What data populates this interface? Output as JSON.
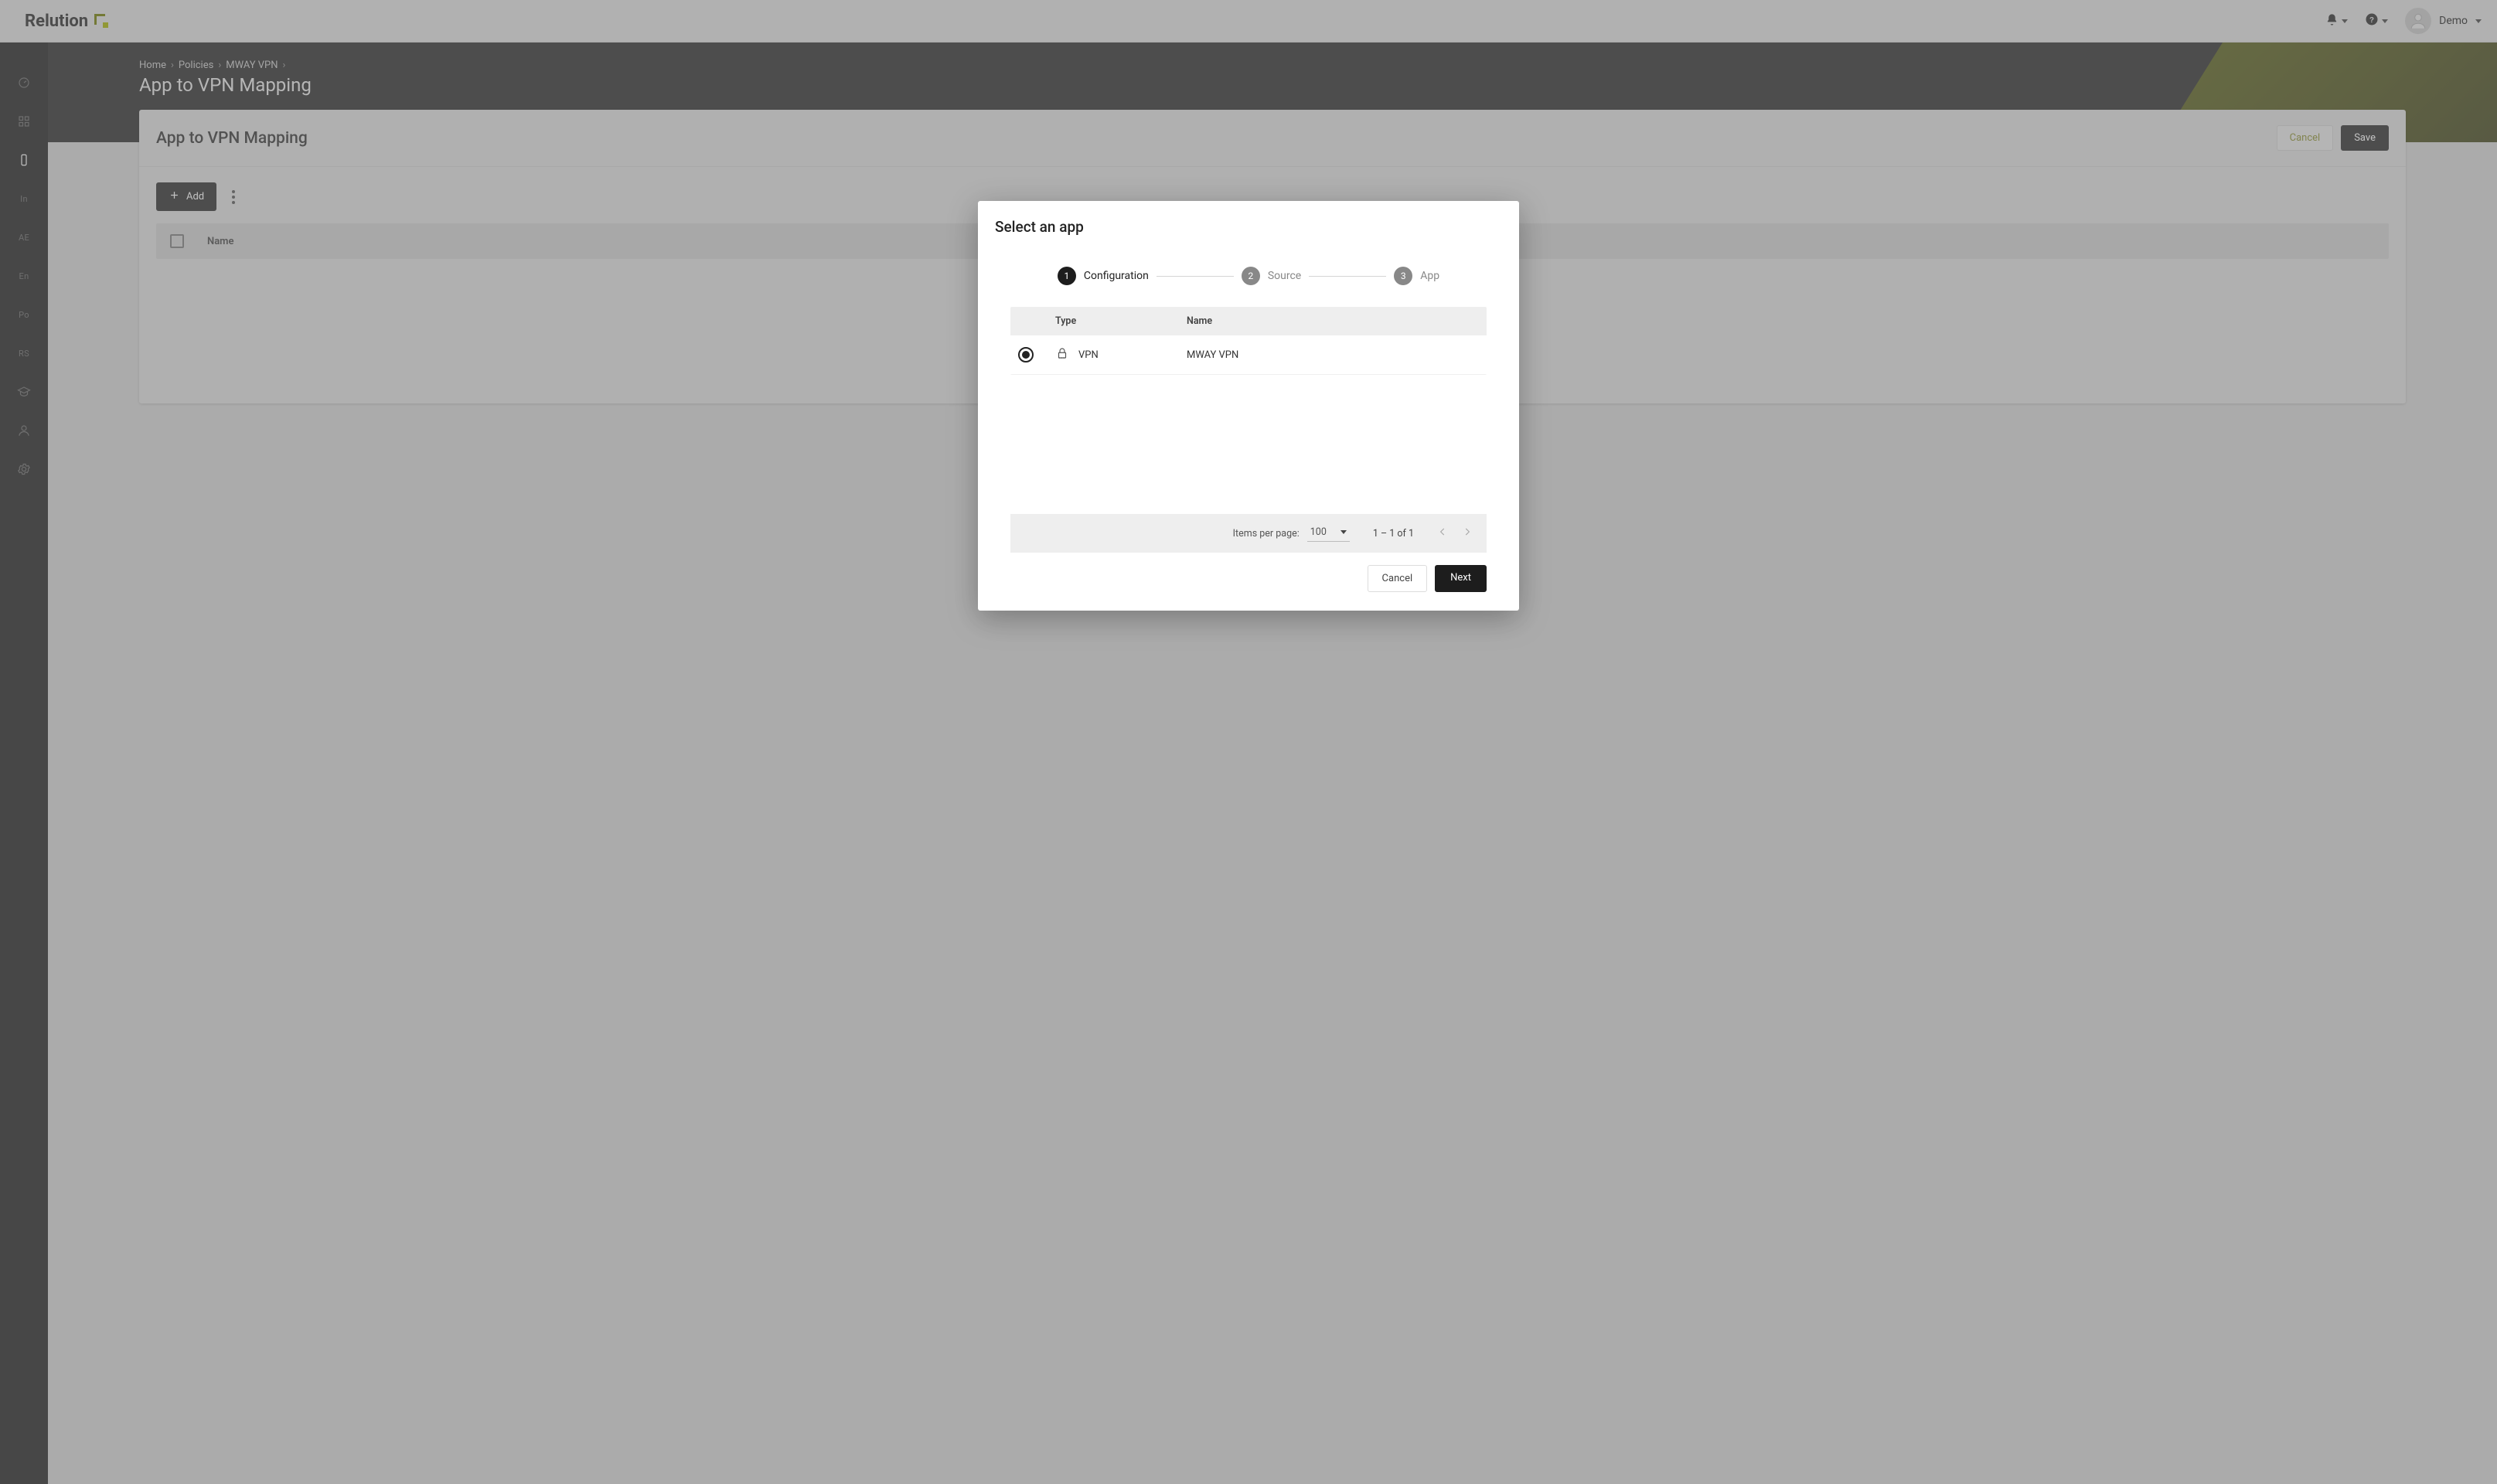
{
  "brand": {
    "name": "Relution"
  },
  "topbar": {
    "user_name": "Demo"
  },
  "sidebar": {
    "items": [
      {
        "kind": "icon",
        "name": "dashboard-icon"
      },
      {
        "kind": "icon",
        "name": "apps-icon"
      },
      {
        "kind": "icon",
        "name": "device-icon",
        "active": true
      },
      {
        "kind": "text",
        "label": "In"
      },
      {
        "kind": "text",
        "label": "AE"
      },
      {
        "kind": "text",
        "label": "En"
      },
      {
        "kind": "text",
        "label": "Po"
      },
      {
        "kind": "text",
        "label": "RS"
      },
      {
        "kind": "icon",
        "name": "education-icon"
      },
      {
        "kind": "icon",
        "name": "user-icon"
      },
      {
        "kind": "icon",
        "name": "settings-gear-icon"
      }
    ]
  },
  "breadcrumbs": {
    "items": [
      "Home",
      "Policies",
      "MWAY VPN"
    ],
    "current": "App to VPN Mapping"
  },
  "page": {
    "title": "App to VPN Mapping"
  },
  "card": {
    "title": "App to VPN Mapping",
    "cancel_label": "Cancel",
    "save_label": "Save",
    "add_label": "Add",
    "columns": {
      "name": "Name"
    }
  },
  "modal": {
    "title": "Select an app",
    "steps": [
      {
        "num": "1",
        "label": "Configuration",
        "active": true
      },
      {
        "num": "2",
        "label": "Source",
        "active": false
      },
      {
        "num": "3",
        "label": "App",
        "active": false
      }
    ],
    "table": {
      "headers": {
        "type": "Type",
        "name": "Name"
      },
      "rows": [
        {
          "selected": true,
          "type_label": "VPN",
          "name": "MWAY VPN"
        }
      ]
    },
    "paginator": {
      "ipp_label": "Items per page:",
      "ipp_value": "100",
      "range": "1 – 1 of 1"
    },
    "cancel_label": "Cancel",
    "next_label": "Next"
  }
}
